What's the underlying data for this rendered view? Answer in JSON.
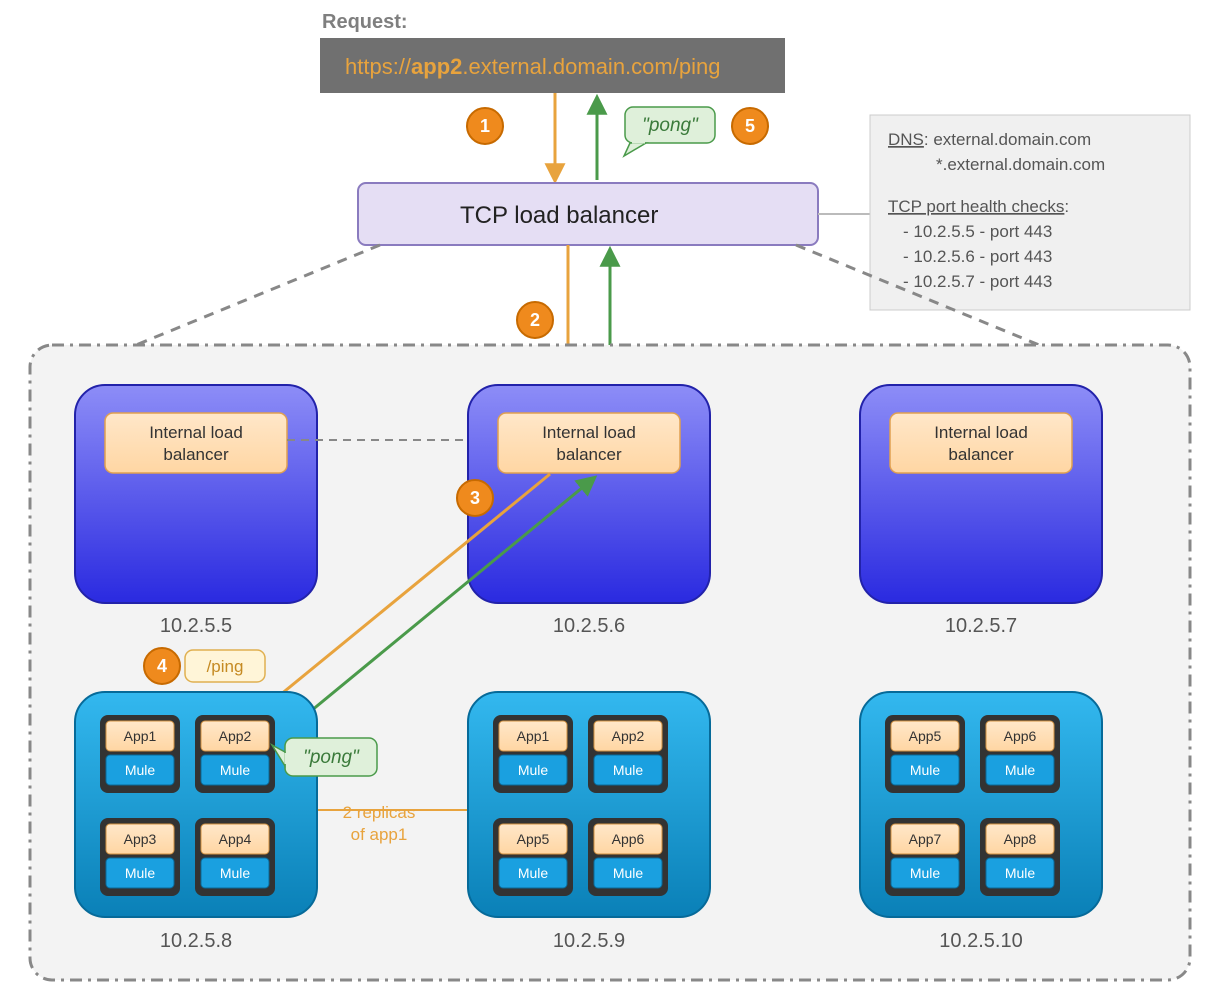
{
  "request": {
    "label": "Request:",
    "url_prefix": "https://",
    "url_bold": "app2",
    "url_suffix": ".external.domain.com/ping"
  },
  "tcp_lb": "TCP load balancer",
  "info": {
    "dns_label": "DNS",
    "dns_primary": ": external.domain.com",
    "dns_wild": "*.external.domain.com",
    "health_label": "TCP port health checks",
    "health_colon": ":",
    "checks": [
      "- 10.2.5.5 - port 443",
      "- 10.2.5.6 - port 443",
      "- 10.2.5.7 - port 443"
    ]
  },
  "steps": {
    "s1": "1",
    "s2": "2",
    "s3": "3",
    "s4": "4",
    "s5": "5"
  },
  "pong_top": "\"pong\"",
  "pong_app": "\"pong\"",
  "ping": "/ping",
  "ilb": "Internal load balancer",
  "replicas": {
    "line1": "2 replicas",
    "line2": "of app1"
  },
  "nodes": {
    "top": [
      {
        "ip": "10.2.5.5"
      },
      {
        "ip": "10.2.5.6"
      },
      {
        "ip": "10.2.5.7"
      }
    ],
    "bottom": [
      {
        "ip": "10.2.5.8",
        "apps": [
          "App1",
          "App2",
          "App3",
          "App4"
        ]
      },
      {
        "ip": "10.2.5.9",
        "apps": [
          "App1",
          "App2",
          "App5",
          "App6"
        ]
      },
      {
        "ip": "10.2.5.10",
        "apps": [
          "App5",
          "App6",
          "App7",
          "App8"
        ]
      }
    ]
  },
  "mule": "Mule"
}
